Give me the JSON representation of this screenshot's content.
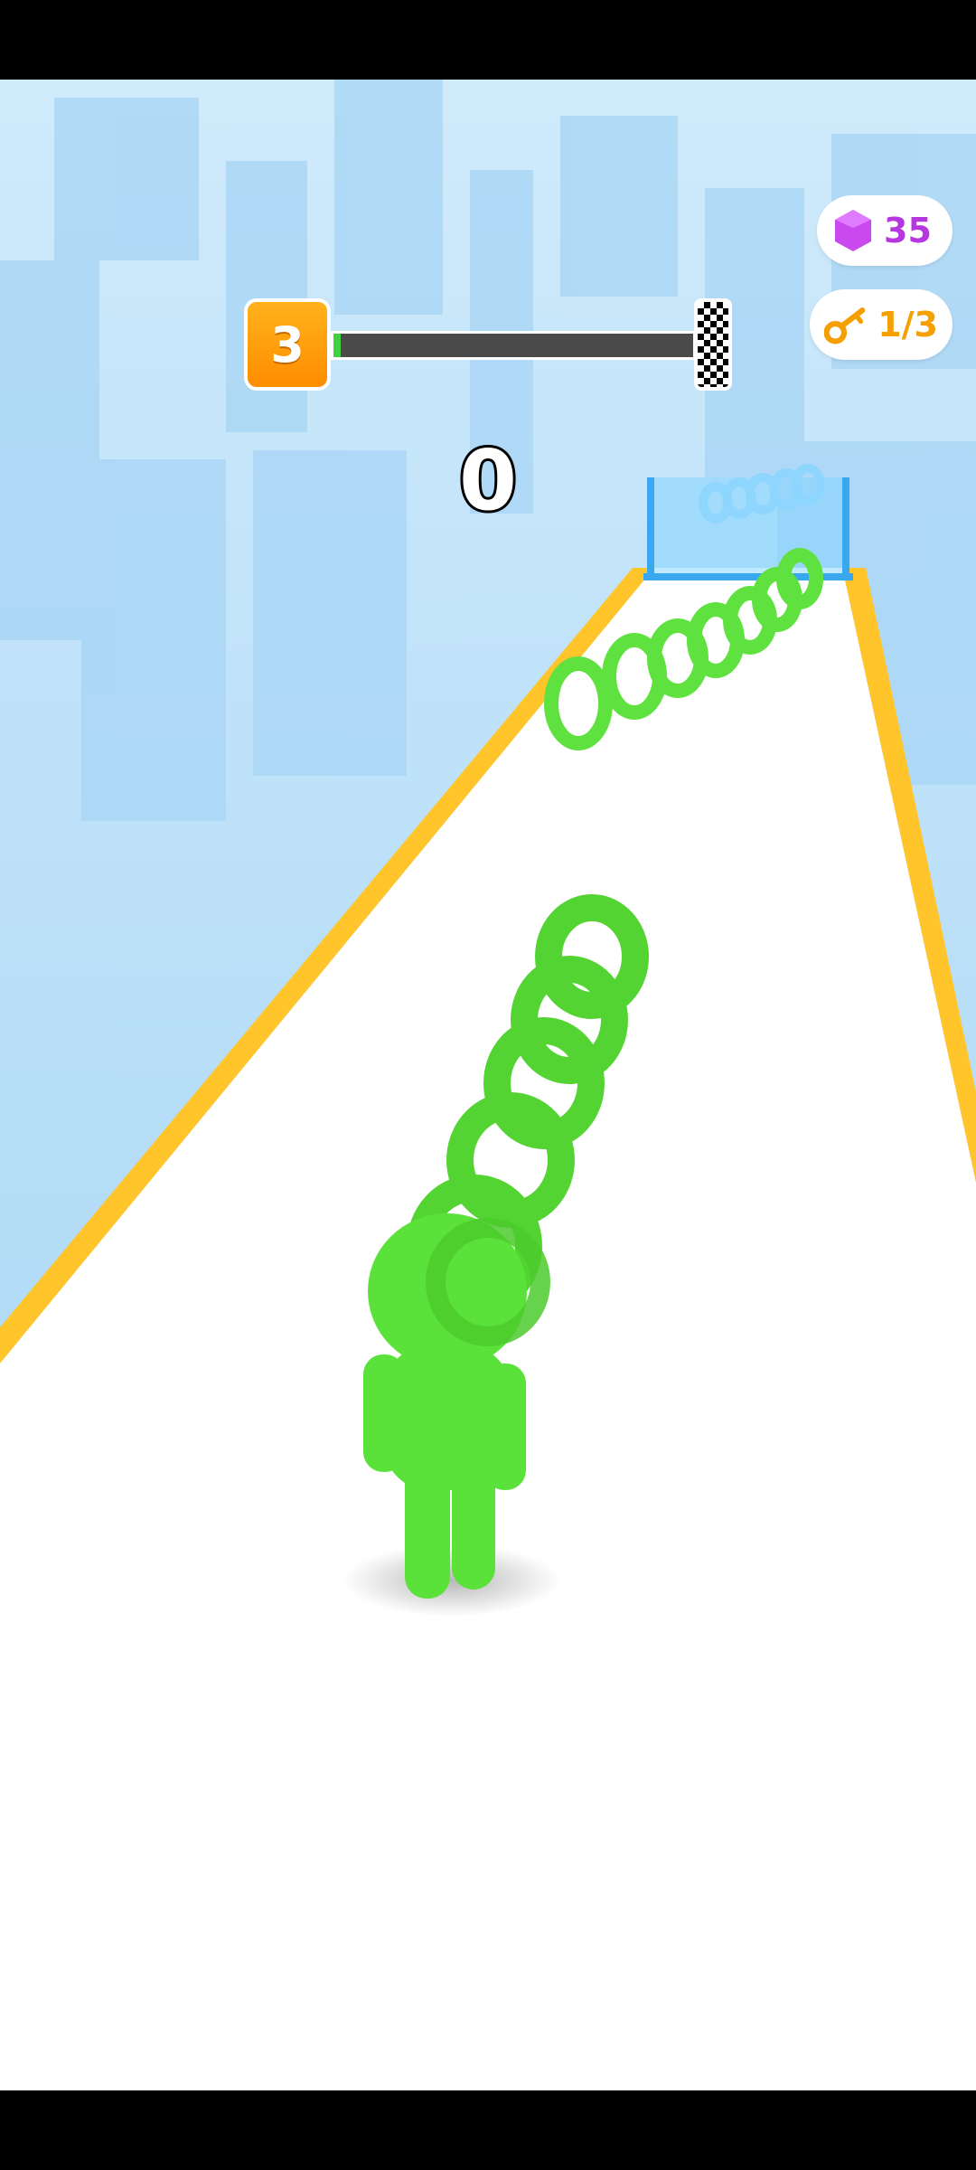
{
  "hud": {
    "level": "3",
    "level_progress": 0.02,
    "gems": "35",
    "keys": "1/3",
    "score": "0"
  },
  "colors": {
    "sky": "#bfe3f8",
    "track": "#ffffff",
    "track_edge": "#ffc52b",
    "rings": "#5fe23f",
    "level_badge": "#ff9d0a",
    "gem": "#b636e0",
    "key": "#f5a000"
  },
  "icons": {
    "gem": "gem-icon",
    "key": "key-icon",
    "finish": "checkered-flag-icon"
  }
}
